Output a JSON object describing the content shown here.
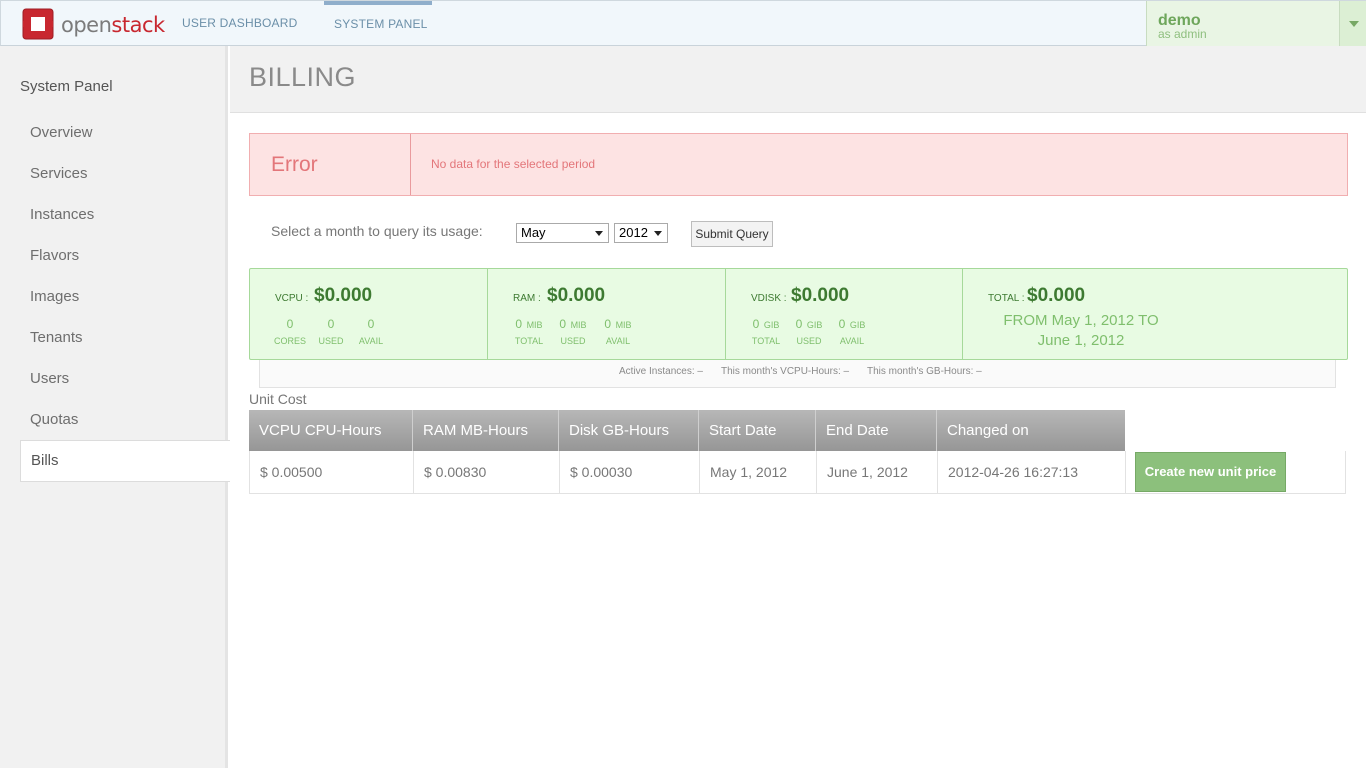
{
  "topbar": {
    "logo_prefix": "open",
    "logo_suffix": "stack",
    "tabs": [
      {
        "label": "USER DASHBOARD",
        "active": false
      },
      {
        "label": "SYSTEM PANEL",
        "active": true
      }
    ],
    "user": {
      "name": "demo",
      "role": "as admin"
    }
  },
  "sidebar": {
    "title": "System Panel",
    "items": [
      {
        "label": "Overview"
      },
      {
        "label": "Services"
      },
      {
        "label": "Instances"
      },
      {
        "label": "Flavors"
      },
      {
        "label": "Images"
      },
      {
        "label": "Tenants"
      },
      {
        "label": "Users"
      },
      {
        "label": "Quotas"
      },
      {
        "label": "Bills",
        "active": true
      }
    ]
  },
  "page": {
    "title": "BILLING"
  },
  "error": {
    "title": "Error",
    "message": "No data for the selected period"
  },
  "query": {
    "label": "Select a month to query its usage:",
    "month": "May",
    "year": "2012",
    "submit_label": "Submit Query"
  },
  "summary": {
    "vcpu": {
      "label": "VCPU :",
      "price": "$0.000",
      "stats": [
        {
          "value": "0",
          "unit": "",
          "label": "CORES"
        },
        {
          "value": "0",
          "unit": "",
          "label": "USED"
        },
        {
          "value": "0",
          "unit": "",
          "label": "AVAIL"
        }
      ]
    },
    "ram": {
      "label": "RAM :",
      "price": "$0.000",
      "stats": [
        {
          "value": "0",
          "unit": "MIB",
          "label": "TOTAL"
        },
        {
          "value": "0",
          "unit": "MIB",
          "label": "USED"
        },
        {
          "value": "0",
          "unit": "MIB",
          "label": "AVAIL"
        }
      ]
    },
    "vdisk": {
      "label": "VDISK :",
      "price": "$0.000",
      "stats": [
        {
          "value": "0",
          "unit": "GIB",
          "label": "TOTAL"
        },
        {
          "value": "0",
          "unit": "GIB",
          "label": "USED"
        },
        {
          "value": "0",
          "unit": "GIB",
          "label": "AVAIL"
        }
      ]
    },
    "total": {
      "label": "TOTAL :",
      "price": "$0.000",
      "range_line1": "FROM May 1, 2012 TO",
      "range_line2": "June 1, 2012"
    }
  },
  "info_bar": {
    "active_instances": "Active Instances: –",
    "vcpu_hours": "This month's VCPU-Hours: –",
    "gb_hours": "This month's GB-Hours: –"
  },
  "unit_cost": {
    "title": "Unit Cost",
    "columns": [
      "VCPU CPU-Hours",
      "RAM MB-Hours",
      "Disk GB-Hours",
      "Start Date",
      "End Date",
      "Changed on"
    ],
    "rows": [
      [
        "$ 0.00500",
        "$ 0.00830",
        "$ 0.00030",
        "May 1, 2012",
        "June 1, 2012",
        "2012-04-26 16:27:13"
      ]
    ],
    "create_label": "Create new unit price"
  }
}
